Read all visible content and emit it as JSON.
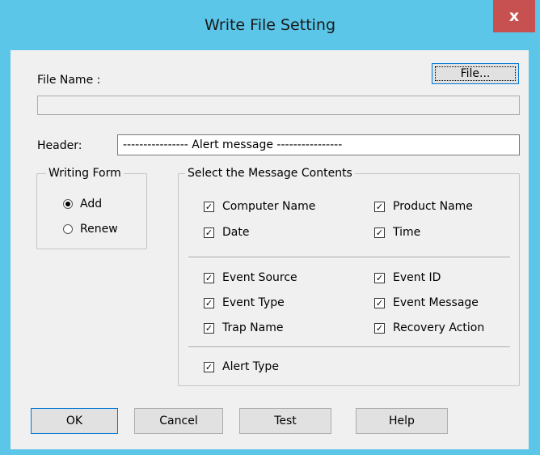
{
  "window": {
    "title": "Write File Setting",
    "close_glyph": "x"
  },
  "file": {
    "label": "File Name :",
    "button": "File...",
    "value": ""
  },
  "header": {
    "label": "Header:",
    "value": "---------------- Alert message ----------------"
  },
  "writing_form": {
    "title": "Writing Form",
    "options": [
      {
        "label": "Add",
        "selected": true
      },
      {
        "label": "Renew",
        "selected": false
      }
    ]
  },
  "message_contents": {
    "title": "Select the Message Contents",
    "items": [
      {
        "label": "Computer Name",
        "checked": true
      },
      {
        "label": "Product Name",
        "checked": true
      },
      {
        "label": "Date",
        "checked": true
      },
      {
        "label": "Time",
        "checked": true
      },
      {
        "label": "Event Source",
        "checked": true
      },
      {
        "label": "Event ID",
        "checked": true
      },
      {
        "label": "Event Type",
        "checked": true
      },
      {
        "label": "Event Message",
        "checked": true
      },
      {
        "label": "Trap Name",
        "checked": true
      },
      {
        "label": "Recovery Action",
        "checked": true
      },
      {
        "label": "Alert Type",
        "checked": true
      }
    ]
  },
  "buttons": {
    "ok": "OK",
    "cancel": "Cancel",
    "test": "Test",
    "help": "Help"
  },
  "colors": {
    "accent": "#5bc6e8",
    "close": "#c75050",
    "face": "#f0f0f0"
  }
}
